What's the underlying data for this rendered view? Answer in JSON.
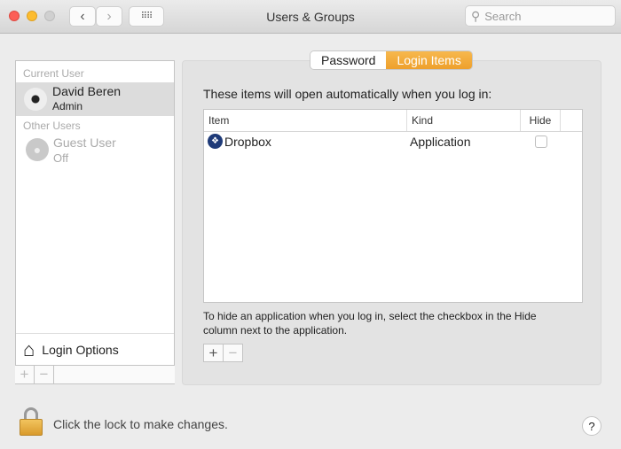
{
  "window": {
    "title": "Users & Groups",
    "search_placeholder": "Search"
  },
  "sidebar": {
    "current_user_header": "Current User",
    "current_user": {
      "name": "David Beren",
      "role": "Admin"
    },
    "other_users_header": "Other Users",
    "other_users": [
      {
        "name": "Guest User",
        "status": "Off"
      }
    ],
    "login_options": "Login Options",
    "add": "+",
    "remove": "−"
  },
  "tabs": [
    {
      "label": "Password",
      "active": false
    },
    {
      "label": "Login Items",
      "active": true
    }
  ],
  "main": {
    "intro": "These items will open automatically when you log in:",
    "columns": [
      "Item",
      "Kind",
      "Hide"
    ],
    "rows": [
      {
        "item": "Dropbox",
        "kind": "Application",
        "hide": false
      }
    ],
    "hint": "To hide an application when you log in, select the checkbox in the Hide column next to the application.",
    "add": "+",
    "remove": "−"
  },
  "footer": {
    "lock_text": "Click the lock to make changes.",
    "help": "?"
  },
  "colors": {
    "accent": "#eea02c"
  }
}
